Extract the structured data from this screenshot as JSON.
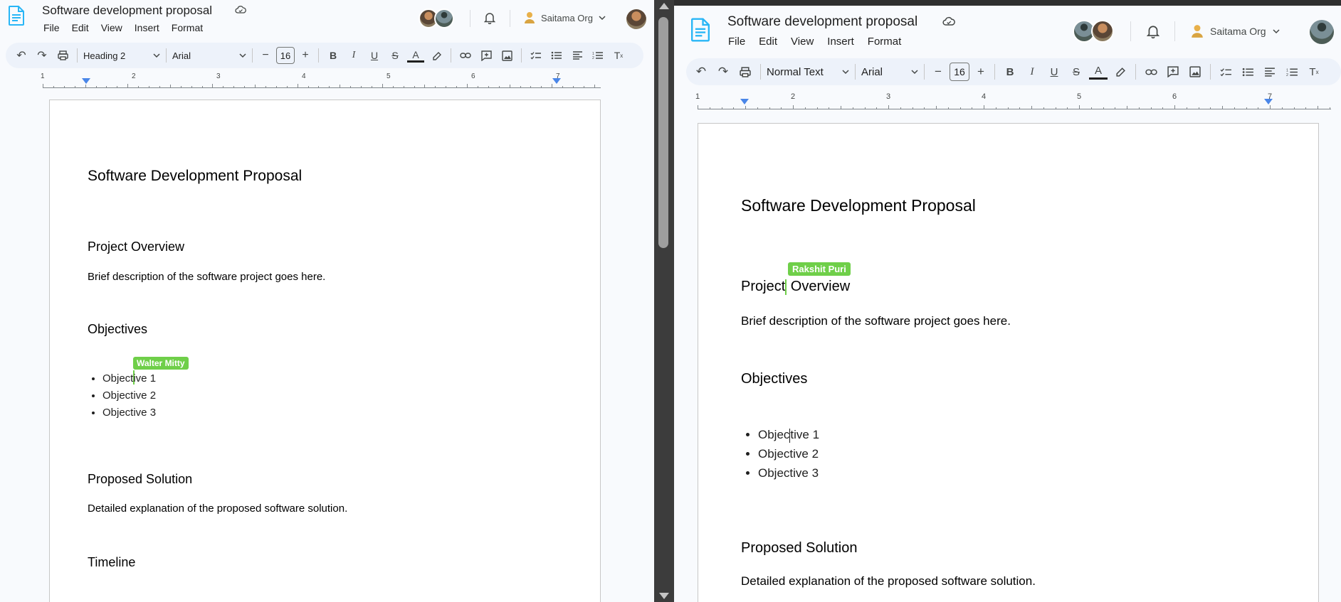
{
  "left": {
    "doc_title": "Software development proposal",
    "menu": [
      "File",
      "Edit",
      "View",
      "Insert",
      "Format"
    ],
    "org_label": "Saitama Org",
    "toolbar": {
      "style_label": "Heading 2",
      "font_label": "Arial",
      "font_size": "16"
    },
    "ruler_numbers": [
      "1",
      "2",
      "3",
      "4",
      "5",
      "6",
      "7"
    ],
    "document": {
      "title": "Software Development Proposal",
      "section_overview": "Project Overview",
      "overview_text": "Brief description of the software project goes here.",
      "section_objectives": "Objectives",
      "objectives": [
        "Objective 1",
        "Objective 2",
        "Objective 3"
      ],
      "section_solution": "Proposed Solution",
      "solution_text": "Detailed explanation of the proposed software solution.",
      "section_timeline": "Timeline"
    },
    "collaborator_cursor": {
      "name": "Walter Mitty",
      "color": "#6fcf49"
    }
  },
  "right": {
    "doc_title": "Software development proposal",
    "menu": [
      "File",
      "Edit",
      "View",
      "Insert",
      "Format"
    ],
    "org_label": "Saitama Org",
    "toolbar": {
      "style_label": "Normal Text",
      "font_label": "Arial",
      "font_size": "16"
    },
    "ruler_numbers": [
      "1",
      "2",
      "3",
      "4",
      "5",
      "6",
      "7"
    ],
    "document": {
      "title": "Software Development Proposal",
      "section_overview_part1": "Project",
      "section_overview_part2": " Overview",
      "overview_text": "Brief description of the software project goes here.",
      "section_objectives": "Objectives",
      "objective_1_part1": "Objec",
      "objective_1_part2": "tive 1",
      "objectives_rest": [
        "Objective 2",
        "Objective 3"
      ],
      "section_solution": "Proposed Solution",
      "solution_text": "Detailed explanation of the proposed software solution."
    },
    "collaborator_cursor": {
      "name": "Rakshit Puri",
      "color": "#6fcf49"
    }
  },
  "colors": {
    "docs_blue": "#2196f3",
    "ruler_marker": "#4a86e8",
    "toolbar_bg": "#edf2fa",
    "chrome_bg": "#f8fafd"
  }
}
